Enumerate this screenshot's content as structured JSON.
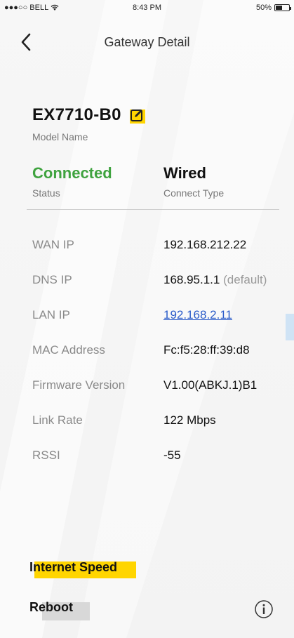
{
  "status_bar": {
    "carrier": "●●●○○ BELL",
    "time": "8:43 PM",
    "battery": "50%",
    "battery_level": 0.5
  },
  "nav": {
    "title": "Gateway Detail",
    "back_icon": "chevron-left-icon"
  },
  "header": {
    "model_name": "EX7710-B0",
    "model_label": "Model Name",
    "edit_icon": "edit-icon",
    "status_value": "Connected",
    "status_label": "Status",
    "status_color": "#3fa33f",
    "connect_type_value": "Wired",
    "connect_type_label": "Connect Type"
  },
  "details": [
    {
      "label": "WAN IP",
      "value": "192.168.212.22"
    },
    {
      "label": "DNS IP",
      "value": "168.95.1.1",
      "suffix": " (default)"
    },
    {
      "label": "LAN IP",
      "value": "192.168.2.11",
      "link": true
    },
    {
      "label": "MAC Address",
      "value": "Fc:f5:28:ff:39:d8"
    },
    {
      "label": "Firmware Version",
      "value": "V1.00(ABKJ.1)B1"
    },
    {
      "label": "Link Rate",
      "value": "122 Mbps"
    },
    {
      "label": "RSSI",
      "value": "-55"
    }
  ],
  "actions": {
    "internet_speed": "Internet Speed",
    "reboot": "Reboot",
    "info_icon": "info-icon"
  },
  "colors": {
    "highlight": "#ffd500",
    "link": "#2b5cc9",
    "connected": "#3fa33f"
  }
}
